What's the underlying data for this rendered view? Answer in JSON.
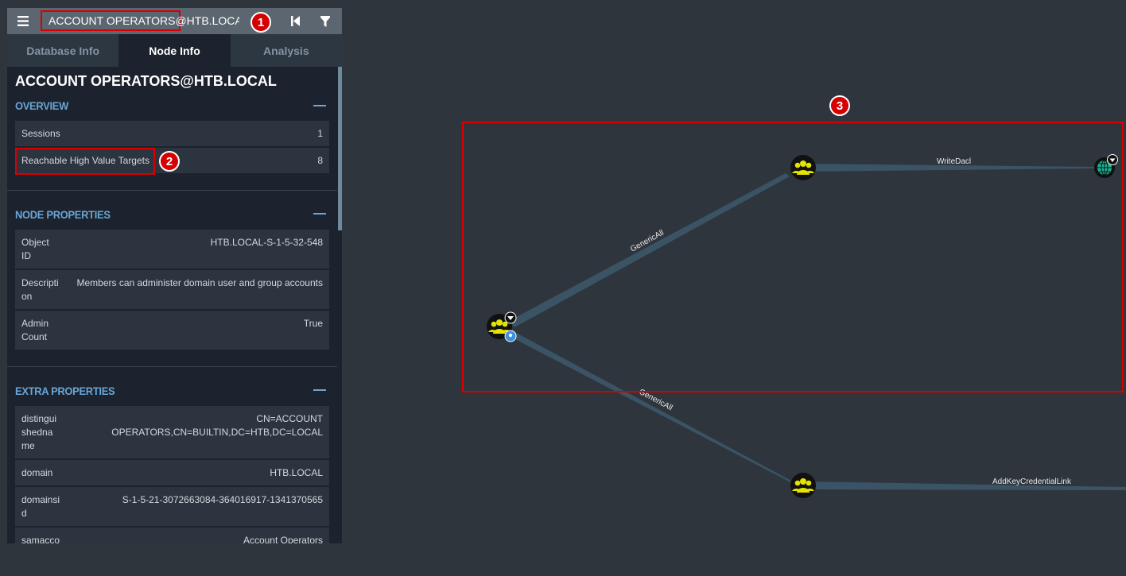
{
  "search": {
    "value": "ACCOUNT OPERATORS@HTB.LOCAL"
  },
  "icons": {
    "menu": "hamburger-icon",
    "back": "skip-back-icon",
    "filter": "filter-icon"
  },
  "tabs": [
    {
      "label": "Database Info",
      "active": false
    },
    {
      "label": "Node Info",
      "active": true
    },
    {
      "label": "Analysis",
      "active": false
    }
  ],
  "node": {
    "title": "ACCOUNT OPERATORS@HTB.LOCAL"
  },
  "overview": {
    "heading": "OVERVIEW",
    "rows": [
      {
        "key": "Sessions",
        "value": "1"
      },
      {
        "key": "Reachable High Value Targets",
        "value": "8"
      }
    ]
  },
  "node_properties": {
    "heading": "NODE PROPERTIES",
    "rows": [
      {
        "key1": "Object",
        "key2": "ID",
        "value1": "HTB.LOCAL-S-1-5-32-548"
      },
      {
        "key1": "Descripti",
        "key2": "on",
        "value1": "Members can administer domain user and group accounts"
      },
      {
        "key1": "Admin",
        "key2": "Count",
        "value1": "True"
      }
    ]
  },
  "extra_properties": {
    "heading": "EXTRA PROPERTIES",
    "rows": [
      {
        "key1": "distingui",
        "key2": "shedna",
        "key3": "me",
        "value1": "CN=ACCOUNT",
        "value2": "OPERATORS,CN=BUILTIN,DC=HTB,DC=LOCAL"
      },
      {
        "key1": "domain",
        "value1": "HTB.LOCAL"
      },
      {
        "key1": "domainsi",
        "key2": "d",
        "value1": "S-1-5-21-3072663084-364016917-1341370565"
      },
      {
        "key1": "samacco",
        "value1": "Account Operators"
      }
    ]
  },
  "annotations": {
    "one": "1",
    "two": "2",
    "three": "3"
  },
  "graph": {
    "edges": {
      "top_left": "GenericAll",
      "bottom_left": "GenericAll",
      "top_right": "WriteDacl",
      "bottom_right": "AddKeyCredentialLink"
    },
    "colors": {
      "group_node": "#e8e800",
      "domain_node": "#1ab394",
      "edge": "#3b5566",
      "highlight": "#d80000"
    }
  }
}
